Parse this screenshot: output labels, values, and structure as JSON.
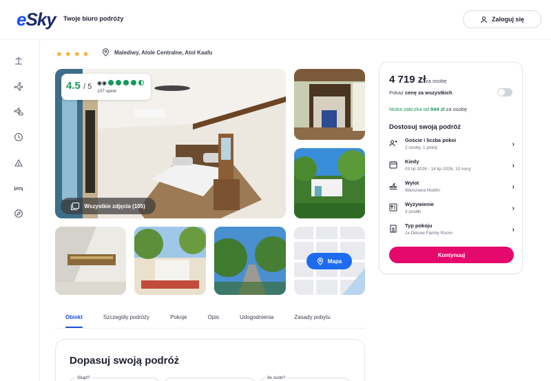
{
  "header": {
    "logo": "eSky",
    "tagline": "Twoje biuro podróży",
    "login_label": "Zaloguj się"
  },
  "sidebar": {
    "icons": [
      "beach-icon",
      "plane-icon",
      "plane-hotel-icon",
      "clock-icon",
      "tent-icon",
      "bed-icon",
      "compass-icon"
    ]
  },
  "hotel": {
    "stars": "★★★★",
    "location": "Malediwy, Atole Centralne, Atol Kaafu",
    "rating": "4.5",
    "rating_max": "/ 5",
    "reviews": "107 opinii",
    "all_photos_label": "Wszystkie zdjęcia (105)",
    "map_label": "Mapa"
  },
  "tabs": [
    "Obiekt",
    "Szczegóły podróży",
    "Pokoje",
    "Opis",
    "Udogodnienia",
    "Zasady pobytu"
  ],
  "section": {
    "title": "Dopasuj swoją podróż",
    "field1_label": "Skąd?",
    "field3_label": "Ile osób?"
  },
  "booking": {
    "price": "4 719 zł",
    "per_person": "za osobę",
    "show_total_prefix": "Pokaż",
    "show_total_bold": "cenę za wszystkich",
    "deposit_prefix": "Niska zaliczka od",
    "deposit_amount": "944 zł",
    "deposit_suffix": "za osobę",
    "customize_title": "Dostosuj swoją podróż",
    "options": [
      {
        "title": "Goście i liczba pokoi",
        "sub": "2 osoby, 1 pokój",
        "icon": "guests-icon"
      },
      {
        "title": "Kiedy",
        "sub": "03 lip 2026 - 14 lip 2026, 10 nocy",
        "icon": "calendar-icon"
      },
      {
        "title": "Wylot",
        "sub": "Warszawa Modlin",
        "icon": "departure-icon"
      },
      {
        "title": "Wyżywienie",
        "sub": "3 posiłki",
        "icon": "meal-icon"
      },
      {
        "title": "Typ pokoju",
        "sub": "1x Deluxe Family Room",
        "icon": "room-icon"
      }
    ],
    "continue_label": "Kontynuuj"
  },
  "colors": {
    "brand_blue": "#1a4cff",
    "rating_green": "#15995a",
    "cta_pink": "#e5086d",
    "tab_blue": "#1d4fd6"
  }
}
